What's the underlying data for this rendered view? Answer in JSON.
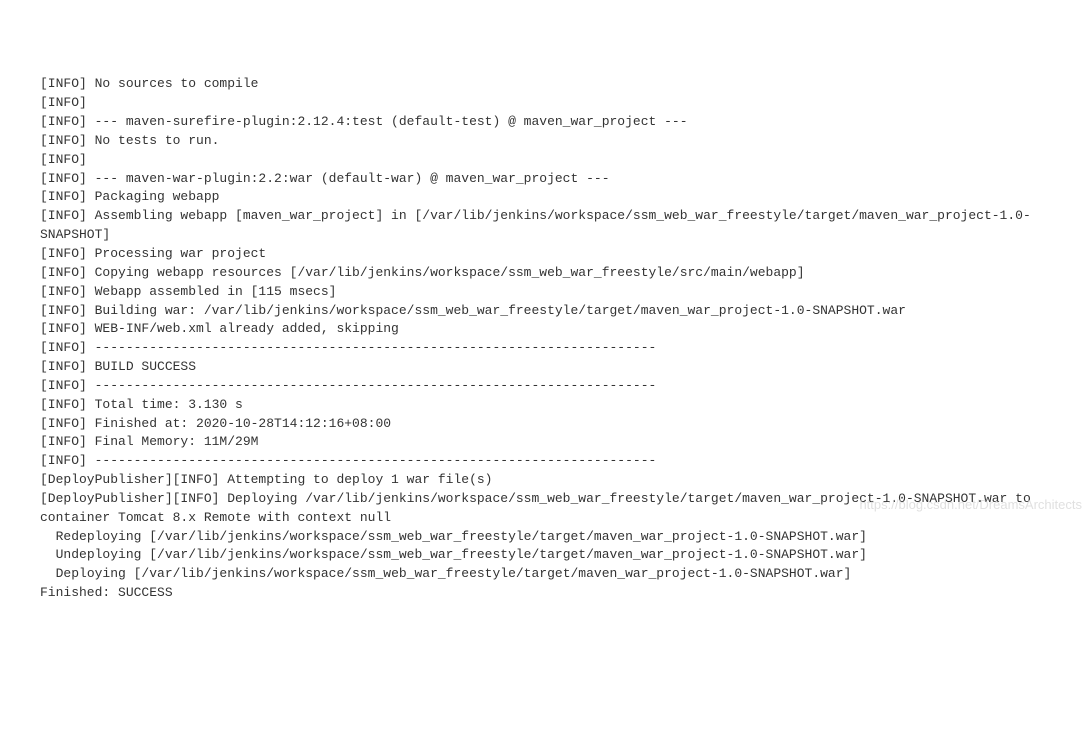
{
  "console": {
    "lines": [
      "[INFO] No sources to compile",
      "[INFO]",
      "[INFO] --- maven-surefire-plugin:2.12.4:test (default-test) @ maven_war_project ---",
      "[INFO] No tests to run.",
      "[INFO]",
      "[INFO] --- maven-war-plugin:2.2:war (default-war) @ maven_war_project ---",
      "[INFO] Packaging webapp",
      "[INFO] Assembling webapp [maven_war_project] in [/var/lib/jenkins/workspace/ssm_web_war_freestyle/target/maven_war_project-1.0-SNAPSHOT]",
      "[INFO] Processing war project",
      "[INFO] Copying webapp resources [/var/lib/jenkins/workspace/ssm_web_war_freestyle/src/main/webapp]",
      "[INFO] Webapp assembled in [115 msecs]",
      "[INFO] Building war: /var/lib/jenkins/workspace/ssm_web_war_freestyle/target/maven_war_project-1.0-SNAPSHOT.war",
      "[INFO] WEB-INF/web.xml already added, skipping",
      "[INFO] ------------------------------------------------------------------------",
      "[INFO] BUILD SUCCESS",
      "[INFO] ------------------------------------------------------------------------",
      "[INFO] Total time: 3.130 s",
      "[INFO] Finished at: 2020-10-28T14:12:16+08:00",
      "[INFO] Final Memory: 11M/29M",
      "[INFO] ------------------------------------------------------------------------",
      "[DeployPublisher][INFO] Attempting to deploy 1 war file(s)",
      "[DeployPublisher][INFO] Deploying /var/lib/jenkins/workspace/ssm_web_war_freestyle/target/maven_war_project-1.0-SNAPSHOT.war to container Tomcat 8.x Remote with context null",
      "  Redeploying [/var/lib/jenkins/workspace/ssm_web_war_freestyle/target/maven_war_project-1.0-SNAPSHOT.war]",
      "  Undeploying [/var/lib/jenkins/workspace/ssm_web_war_freestyle/target/maven_war_project-1.0-SNAPSHOT.war]",
      "  Deploying [/var/lib/jenkins/workspace/ssm_web_war_freestyle/target/maven_war_project-1.0-SNAPSHOT.war]",
      "Finished: SUCCESS"
    ]
  },
  "watermark": "https://blog.csdn.net/DreamsArchitects"
}
